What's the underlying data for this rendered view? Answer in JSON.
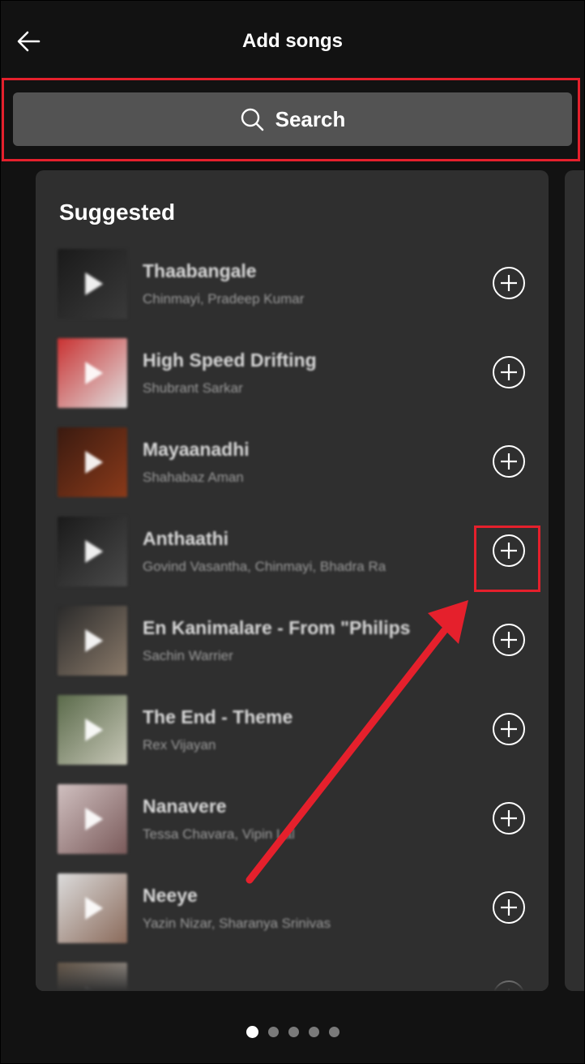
{
  "header": {
    "title": "Add songs",
    "back_icon": "arrow-left-icon"
  },
  "search": {
    "label": "Search",
    "icon": "search-icon"
  },
  "section": {
    "title": "Suggested"
  },
  "songs": [
    {
      "title": "Thaabangale",
      "artist": "Chinmayi, Pradeep Kumar",
      "thumb_colors": [
        "#1a1a1a",
        "#3a3a3a"
      ]
    },
    {
      "title": "High Speed Drifting",
      "artist": "Shubrant Sarkar",
      "thumb_colors": [
        "#c93232",
        "#e0e0e0"
      ]
    },
    {
      "title": "Mayaanadhi",
      "artist": "Shahabaz Aman",
      "thumb_colors": [
        "#3a1a10",
        "#8a3a1a"
      ]
    },
    {
      "title": "Anthaathi",
      "artist": "Govind Vasantha, Chinmayi, Bhadra Ra",
      "thumb_colors": [
        "#1a1a1a",
        "#4a4a4a"
      ]
    },
    {
      "title": "En Kanimalare - From \"Philips",
      "artist": "Sachin Warrier",
      "thumb_colors": [
        "#2a2a2a",
        "#8a7a6a"
      ]
    },
    {
      "title": "The End - Theme",
      "artist": "Rex Vijayan",
      "thumb_colors": [
        "#5a6a4a",
        "#c8c8b8"
      ]
    },
    {
      "title": "Nanavere",
      "artist": "Tessa Chavara, Vipin Lal",
      "thumb_colors": [
        "#d0c0c0",
        "#7a5a5a"
      ]
    },
    {
      "title": "Neeye",
      "artist": "Yazin Nizar, Sharanya Srinivas",
      "thumb_colors": [
        "#dcdcdc",
        "#8a6a5a"
      ]
    },
    {
      "title": "",
      "artist": "",
      "thumb_colors": [
        "#6a5a4a",
        "#bbbbbb"
      ]
    }
  ],
  "add_icon": "plus-circle-icon",
  "pagination": {
    "count": 5,
    "active": 0
  },
  "colors": {
    "background": "#121212",
    "card": "#2f2f2f",
    "search_bar": "#535353",
    "annotation": "#e5202c"
  }
}
